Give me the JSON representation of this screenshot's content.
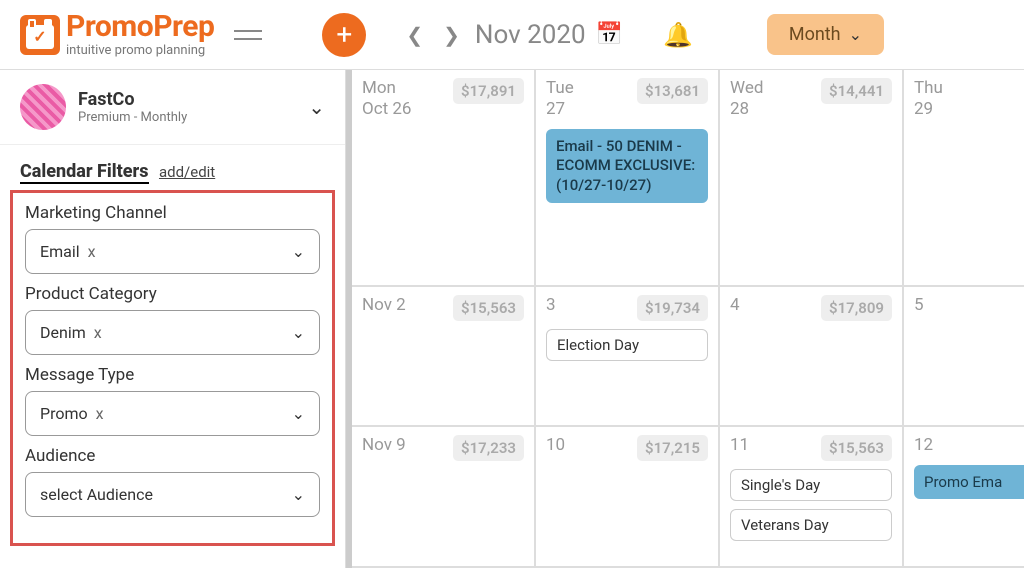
{
  "brand": {
    "name": "PromoPrep",
    "tagline": "intuitive promo planning"
  },
  "header": {
    "date_label": "Nov 2020",
    "view_button": "Month"
  },
  "org": {
    "name": "FastCo",
    "plan": "Premium - Monthly"
  },
  "filters": {
    "title": "Calendar Filters",
    "edit_link": "add/edit",
    "groups": [
      {
        "label": "Marketing Channel",
        "value": "Email",
        "has_x": true
      },
      {
        "label": "Product Category",
        "value": "Denim",
        "has_x": true
      },
      {
        "label": "Message Type",
        "value": "Promo",
        "has_x": true
      },
      {
        "label": "Audience",
        "value": "select Audience",
        "has_x": false
      }
    ]
  },
  "calendar": {
    "rows": [
      [
        {
          "wd": "Mon",
          "dn": "Oct 26",
          "amount": "$17,891",
          "events": []
        },
        {
          "wd": "Tue",
          "dn": "27",
          "amount": "$13,681",
          "events": [
            {
              "type": "blue",
              "text": "Email - 50 DENIM - ECOMM EXCLUSIVE: (10/27-10/27)"
            }
          ]
        },
        {
          "wd": "Wed",
          "dn": "28",
          "amount": "$14,441",
          "events": []
        },
        {
          "wd": "Thu",
          "dn": "29",
          "amount": "",
          "events": []
        }
      ],
      [
        {
          "wd": "",
          "dn": "Nov 2",
          "amount": "$15,563",
          "events": []
        },
        {
          "wd": "",
          "dn": "3",
          "amount": "$19,734",
          "events": [
            {
              "type": "white",
              "text": "Election Day"
            }
          ]
        },
        {
          "wd": "",
          "dn": "4",
          "amount": "$17,809",
          "events": []
        },
        {
          "wd": "",
          "dn": "5",
          "amount": "",
          "events": []
        }
      ],
      [
        {
          "wd": "",
          "dn": "Nov 9",
          "amount": "$17,233",
          "events": []
        },
        {
          "wd": "",
          "dn": "10",
          "amount": "$17,215",
          "events": []
        },
        {
          "wd": "",
          "dn": "11",
          "amount": "$15,563",
          "events": [
            {
              "type": "white",
              "text": "Single's Day"
            },
            {
              "type": "white",
              "text": "Veterans Day"
            }
          ]
        },
        {
          "wd": "",
          "dn": "12",
          "amount": "",
          "events": [
            {
              "type": "promo",
              "text": "Promo Ema"
            }
          ]
        }
      ]
    ]
  }
}
